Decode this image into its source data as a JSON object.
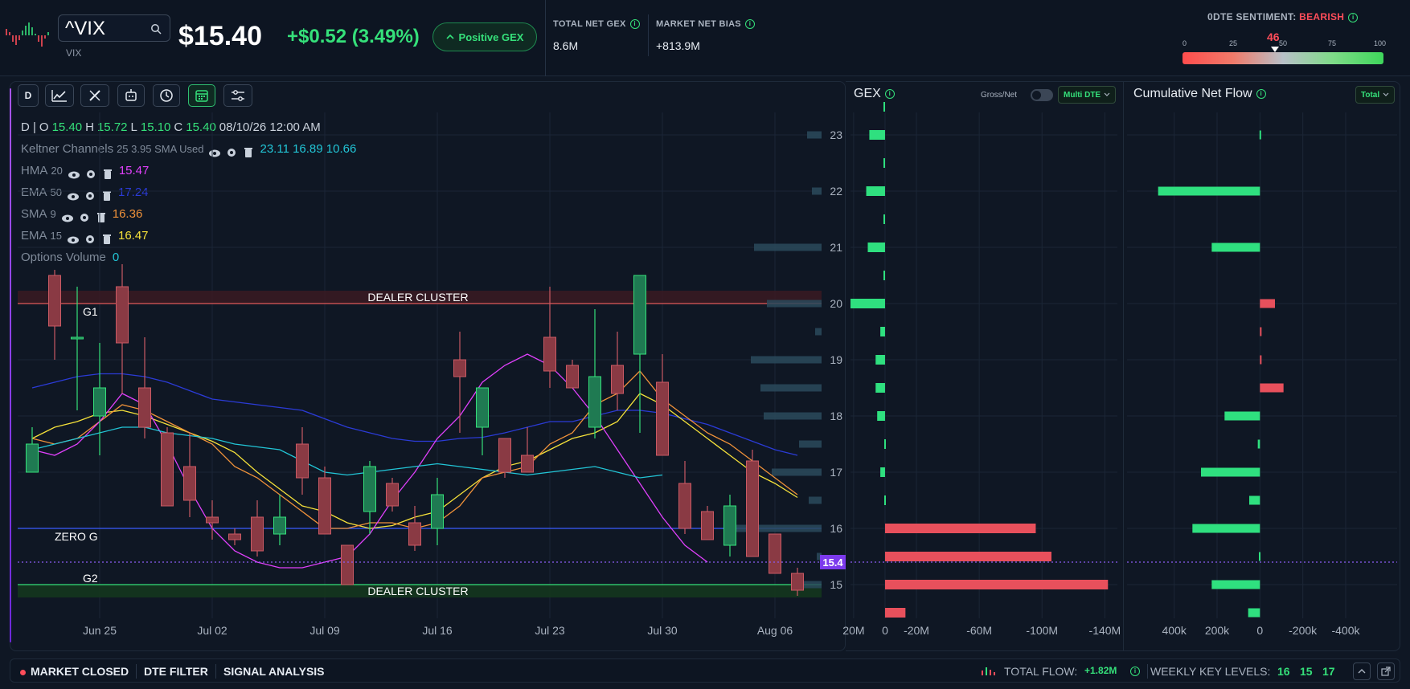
{
  "header": {
    "symbol": "^VIX",
    "symbol_sub": "VIX",
    "price": "$15.40",
    "change": "+$0.52 (3.49%)",
    "gex_pill": "Positive GEX",
    "total_net_gex_label": "TOTAL NET GEX",
    "total_net_gex_value": "8.6M",
    "market_net_bias_label": "MARKET NET BIAS",
    "market_net_bias_value": "+813.9M",
    "sentiment_label": "0DTE SENTIMENT:",
    "sentiment_value": "BEARISH",
    "sentiment_score": "46",
    "sentiment_score_fraction": 0.46,
    "sentiment_ticks": [
      "0",
      "25",
      "50",
      "75",
      "100"
    ]
  },
  "toolbar": {
    "interval": "D"
  },
  "legend": {
    "ohlc_prefix": "D | ",
    "o_label": "O",
    "o_val": "15.40",
    "h_label": "H",
    "h_val": "15.72",
    "l_label": "L",
    "l_val": "15.10",
    "c_label": "C",
    "c_val": "15.40",
    "date": "08/10/26 12:00 AM",
    "indicators": [
      {
        "name": "Keltner Channels",
        "params": "25 3.95 SMA Used",
        "values": "23.11 16.89 10.66",
        "color": "#22c5d6"
      },
      {
        "name": "HMA",
        "params": "20",
        "values": "15.47",
        "color": "#e040fb"
      },
      {
        "name": "EMA",
        "params": "50",
        "values": "17.24",
        "color": "#2b3bd6"
      },
      {
        "name": "SMA",
        "params": "9",
        "values": "16.36",
        "color": "#f0923a"
      },
      {
        "name": "EMA",
        "params": "15",
        "values": "16.47",
        "color": "#f5e13a"
      },
      {
        "name": "Options Volume",
        "params": "",
        "values": "0",
        "color": "#22c5d6"
      }
    ]
  },
  "chart_labels": {
    "dealer_cluster_top": "DEALER CLUSTER",
    "dealer_cluster_bottom": "DEALER CLUSTER",
    "g1": "G1",
    "g2": "G2",
    "zero_g": "ZERO G",
    "price_tag": "15.4"
  },
  "chart_data": [
    {
      "type": "candlestick",
      "title": "",
      "x_ticks": [
        "Jun 25",
        "Jul 02",
        "Jul 09",
        "Jul 16",
        "Jul 23",
        "Jul 30",
        "Aug 06"
      ],
      "y_ticks": [
        15,
        16,
        17,
        18,
        19,
        20,
        21,
        22,
        23
      ],
      "ylim": [
        14.4,
        23.4
      ],
      "levels": {
        "dealer_cluster_top": 20.0,
        "zero_g": 16.0,
        "dealer_cluster_bottom": 15.0,
        "current_price": 15.4
      },
      "candles": [
        {
          "o": 17.5,
          "h": 17.8,
          "l": 17.0,
          "c": 17.0,
          "dir": "up"
        },
        {
          "o": 20.5,
          "h": 20.6,
          "l": 19.0,
          "c": 19.6,
          "dir": "down"
        },
        {
          "o": 19.4,
          "h": 20.3,
          "l": 18.1,
          "c": 19.4,
          "dir": "up"
        },
        {
          "o": 18.0,
          "h": 19.3,
          "l": 17.3,
          "c": 18.5,
          "dir": "up"
        },
        {
          "o": 20.3,
          "h": 20.7,
          "l": 18.4,
          "c": 19.3,
          "dir": "down"
        },
        {
          "o": 18.5,
          "h": 19.4,
          "l": 17.6,
          "c": 17.8,
          "dir": "down"
        },
        {
          "o": 17.7,
          "h": 17.8,
          "l": 16.4,
          "c": 16.4,
          "dir": "down"
        },
        {
          "o": 17.1,
          "h": 17.7,
          "l": 16.2,
          "c": 16.5,
          "dir": "down"
        },
        {
          "o": 16.2,
          "h": 16.5,
          "l": 15.8,
          "c": 16.1,
          "dir": "down"
        },
        {
          "o": 15.9,
          "h": 16.0,
          "l": 15.7,
          "c": 15.8,
          "dir": "down"
        },
        {
          "o": 16.2,
          "h": 16.5,
          "l": 15.5,
          "c": 15.6,
          "dir": "down"
        },
        {
          "o": 15.9,
          "h": 16.6,
          "l": 15.7,
          "c": 16.2,
          "dir": "up"
        },
        {
          "o": 17.5,
          "h": 17.8,
          "l": 16.6,
          "c": 16.9,
          "dir": "down"
        },
        {
          "o": 16.9,
          "h": 17.1,
          "l": 15.9,
          "c": 15.9,
          "dir": "down"
        },
        {
          "o": 15.7,
          "h": 15.7,
          "l": 15.0,
          "c": 15.0,
          "dir": "down"
        },
        {
          "o": 16.3,
          "h": 17.2,
          "l": 15.9,
          "c": 17.1,
          "dir": "up"
        },
        {
          "o": 16.8,
          "h": 16.9,
          "l": 16.3,
          "c": 16.4,
          "dir": "down"
        },
        {
          "o": 16.1,
          "h": 16.4,
          "l": 15.6,
          "c": 15.7,
          "dir": "down"
        },
        {
          "o": 16.0,
          "h": 16.9,
          "l": 15.7,
          "c": 16.6,
          "dir": "up"
        },
        {
          "o": 19.0,
          "h": 19.5,
          "l": 17.7,
          "c": 18.7,
          "dir": "down"
        },
        {
          "o": 17.8,
          "h": 18.5,
          "l": 17.3,
          "c": 18.5,
          "dir": "up"
        },
        {
          "o": 17.6,
          "h": 17.6,
          "l": 16.9,
          "c": 17.0,
          "dir": "down"
        },
        {
          "o": 17.3,
          "h": 17.8,
          "l": 17.0,
          "c": 17.0,
          "dir": "down"
        },
        {
          "o": 19.4,
          "h": 20.3,
          "l": 18.5,
          "c": 18.8,
          "dir": "down"
        },
        {
          "o": 18.9,
          "h": 19.0,
          "l": 18.5,
          "c": 18.5,
          "dir": "down"
        },
        {
          "o": 17.8,
          "h": 19.9,
          "l": 17.6,
          "c": 18.7,
          "dir": "up"
        },
        {
          "o": 18.9,
          "h": 19.5,
          "l": 18.1,
          "c": 18.4,
          "dir": "down"
        },
        {
          "o": 19.1,
          "h": 20.5,
          "l": 17.7,
          "c": 20.5,
          "dir": "up"
        },
        {
          "o": 18.6,
          "h": 19.1,
          "l": 17.5,
          "c": 17.3,
          "dir": "down"
        },
        {
          "o": 16.8,
          "h": 17.2,
          "l": 15.9,
          "c": 16.0,
          "dir": "down"
        },
        {
          "o": 16.3,
          "h": 16.4,
          "l": 15.9,
          "c": 15.8,
          "dir": "down"
        },
        {
          "o": 15.7,
          "h": 16.6,
          "l": 15.5,
          "c": 16.4,
          "dir": "up"
        },
        {
          "o": 17.2,
          "h": 17.4,
          "l": 15.8,
          "c": 15.5,
          "dir": "down"
        },
        {
          "o": 15.9,
          "h": 15.9,
          "l": 15.2,
          "c": 15.2,
          "dir": "down"
        },
        {
          "o": 15.2,
          "h": 15.3,
          "l": 14.8,
          "c": 14.9,
          "dir": "down"
        }
      ]
    },
    {
      "type": "bar",
      "title": "GEX",
      "orientation": "horizontal",
      "x_ticks": [
        "20M",
        "0",
        "-20M",
        "-60M",
        "-100M",
        "-140M"
      ],
      "xlim": [
        22,
        -148
      ],
      "strikes": [
        23.5,
        23,
        22.5,
        22,
        21.5,
        21,
        20.5,
        20,
        19.5,
        19,
        18.5,
        18,
        17.5,
        17,
        16.5,
        16,
        15.5,
        15,
        14.5
      ],
      "values": [
        1,
        10,
        1,
        12,
        1,
        11,
        1,
        22,
        3,
        6,
        6,
        5,
        0.5,
        3,
        0.5,
        -96,
        -106,
        -142,
        -13
      ]
    },
    {
      "type": "bar",
      "title": "Cumulative Net Flow",
      "orientation": "horizontal",
      "x_ticks": [
        "400k",
        "200k",
        "0",
        "-200k",
        "-400k"
      ],
      "xlim": [
        620,
        -640
      ],
      "strikes": [
        23,
        22,
        21,
        20,
        19.5,
        19,
        18.5,
        18,
        17.5,
        17,
        16.5,
        16,
        15.5,
        15,
        14.5
      ],
      "values": [
        2,
        475,
        225,
        -70,
        -5,
        -3,
        -110,
        165,
        10,
        275,
        50,
        315,
        5,
        225,
        55
      ]
    }
  ],
  "gex_panel": {
    "title": "GEX",
    "toggle_label": "Gross/Net",
    "dropdown": "Multi DTE"
  },
  "flow_panel": {
    "title": "Cumulative Net Flow",
    "dropdown": "Total"
  },
  "bottombar": {
    "status": "MARKET CLOSED",
    "dte_filter": "DTE FILTER",
    "signal_analysis": "SIGNAL ANALYSIS",
    "total_flow_label": "TOTAL FLOW:",
    "total_flow_value": "+1.82M",
    "weekly_key_levels_label": "WEEKLY KEY LEVELS:",
    "key_levels": [
      "16",
      "15",
      "17"
    ]
  }
}
